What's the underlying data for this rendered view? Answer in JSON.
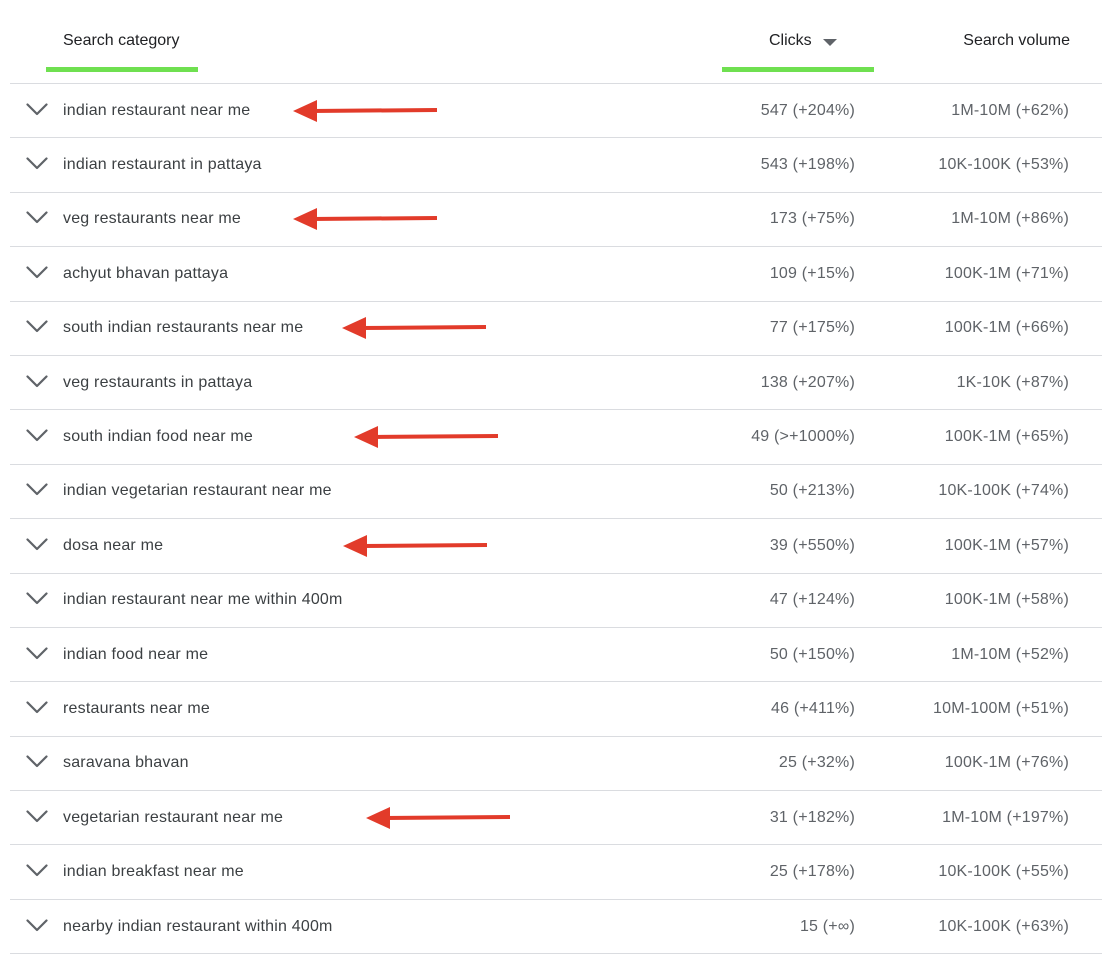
{
  "header": {
    "category_label": "Search category",
    "clicks_label": "Clicks",
    "volume_label": "Search volume"
  },
  "colors": {
    "active_underline": "#6fe050",
    "annotation_arrow": "#e23b2a"
  },
  "rows": [
    {
      "category": "indian restaurant near me",
      "clicks": "547 (+204%)",
      "volume": "1M-10M (+62%)",
      "arrow": true
    },
    {
      "category": "indian restaurant in pattaya",
      "clicks": "543 (+198%)",
      "volume": "10K-100K (+53%)",
      "arrow": false
    },
    {
      "category": "veg restaurants near me",
      "clicks": "173 (+75%)",
      "volume": "1M-10M (+86%)",
      "arrow": true
    },
    {
      "category": "achyut bhavan pattaya",
      "clicks": "109 (+15%)",
      "volume": "100K-1M (+71%)",
      "arrow": false
    },
    {
      "category": "south indian restaurants near me",
      "clicks": "77 (+175%)",
      "volume": "100K-1M (+66%)",
      "arrow": true
    },
    {
      "category": "veg restaurants in pattaya",
      "clicks": "138 (+207%)",
      "volume": "1K-10K (+87%)",
      "arrow": false
    },
    {
      "category": "south indian food near me",
      "clicks": "49 (>+1000%)",
      "volume": "100K-1M (+65%)",
      "arrow": true
    },
    {
      "category": "indian vegetarian restaurant near me",
      "clicks": "50 (+213%)",
      "volume": "10K-100K (+74%)",
      "arrow": false
    },
    {
      "category": "dosa near me",
      "clicks": "39 (+550%)",
      "volume": "100K-1M (+57%)",
      "arrow": true
    },
    {
      "category": "indian restaurant near me within 400m",
      "clicks": "47 (+124%)",
      "volume": "100K-1M (+58%)",
      "arrow": false
    },
    {
      "category": "indian food near me",
      "clicks": "50 (+150%)",
      "volume": "1M-10M (+52%)",
      "arrow": false
    },
    {
      "category": "restaurants near me",
      "clicks": "46 (+411%)",
      "volume": "10M-100M (+51%)",
      "arrow": false
    },
    {
      "category": "saravana bhavan",
      "clicks": "25 (+32%)",
      "volume": "100K-1M (+76%)",
      "arrow": false
    },
    {
      "category": "vegetarian restaurant near me",
      "clicks": "31 (+182%)",
      "volume": "1M-10M (+197%)",
      "arrow": true
    },
    {
      "category": "indian breakfast near me",
      "clicks": "25 (+178%)",
      "volume": "10K-100K (+55%)",
      "arrow": false
    },
    {
      "category": "nearby indian restaurant within 400m",
      "clicks": "15 (+∞)",
      "volume": "10K-100K (+63%)",
      "arrow": false
    }
  ]
}
